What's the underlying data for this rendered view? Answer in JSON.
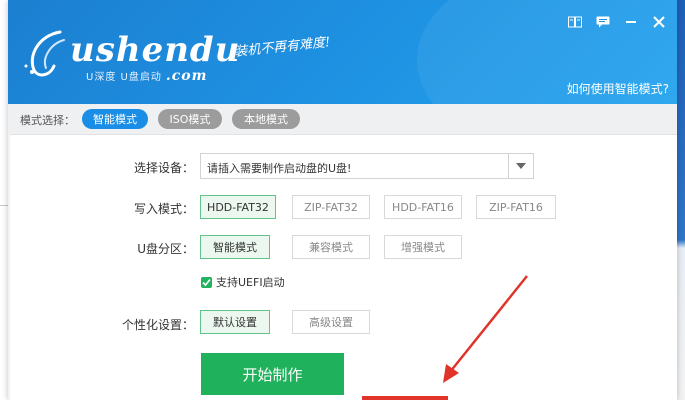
{
  "header": {
    "logo_text": "ushendu",
    "logo_sub": "U深度 U盘启动",
    "logo_dotcom": ".com",
    "slogan": "装机不再有难度!",
    "help_link": "如何使用智能模式?"
  },
  "window_controls": {
    "book": "book-icon",
    "message": "message-icon",
    "minimize": "minimize-icon",
    "close": "close-icon"
  },
  "modebar": {
    "label": "模式选择：",
    "modes": [
      {
        "label": "智能模式",
        "active": true
      },
      {
        "label": "ISO模式",
        "active": false
      },
      {
        "label": "本地模式",
        "active": false
      }
    ]
  },
  "form": {
    "device_label": "选择设备：",
    "device_placeholder": "请插入需要制作启动盘的U盘!",
    "write_label": "写入模式：",
    "write_options": [
      "HDD-FAT32",
      "ZIP-FAT32",
      "HDD-FAT16",
      "ZIP-FAT16"
    ],
    "write_selected": "HDD-FAT32",
    "partition_label": "U盘分区：",
    "partition_options": [
      "智能模式",
      "兼容模式",
      "增强模式"
    ],
    "partition_selected": "智能模式",
    "uefi_label": "支持UEFI启动",
    "uefi_checked": true,
    "personal_label": "个性化设置：",
    "personal_options": [
      "默认设置",
      "高级设置"
    ],
    "personal_selected": "默认设置",
    "start_button": "开始制作"
  },
  "colors": {
    "header_blue": "#1e8fe0",
    "active_pill": "#1a8ee6",
    "inactive_pill": "#9c9c9c",
    "start_green": "#1fb15b",
    "annotation_red": "#e0342a"
  }
}
